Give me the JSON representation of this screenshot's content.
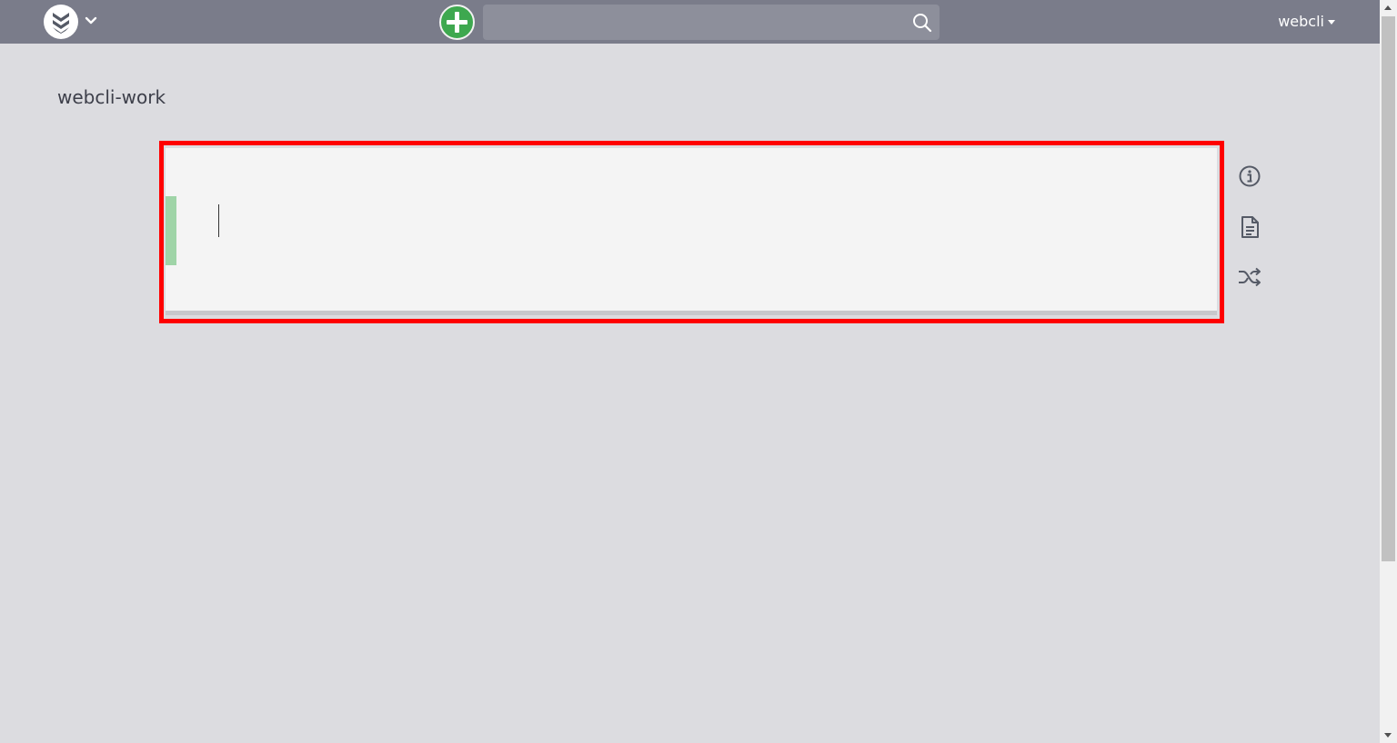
{
  "header": {
    "logo_icon": "cocalc-logo-icon",
    "logo_menu_icon": "chevron-down-icon",
    "add_icon": "plus-icon",
    "add_color": "#3ea84f",
    "search": {
      "value": "",
      "placeholder": ""
    },
    "search_icon": "search-icon",
    "user_label": "webcli",
    "bar_color": "#7a7c8a"
  },
  "page": {
    "title": "webcli-work"
  },
  "cell": {
    "content": "",
    "marker_color": "#9fd4a7",
    "highlight_color": "#ff0000"
  },
  "side_toolbar": [
    {
      "icon": "info-icon"
    },
    {
      "icon": "document-icon"
    },
    {
      "icon": "shuffle-icon"
    }
  ]
}
